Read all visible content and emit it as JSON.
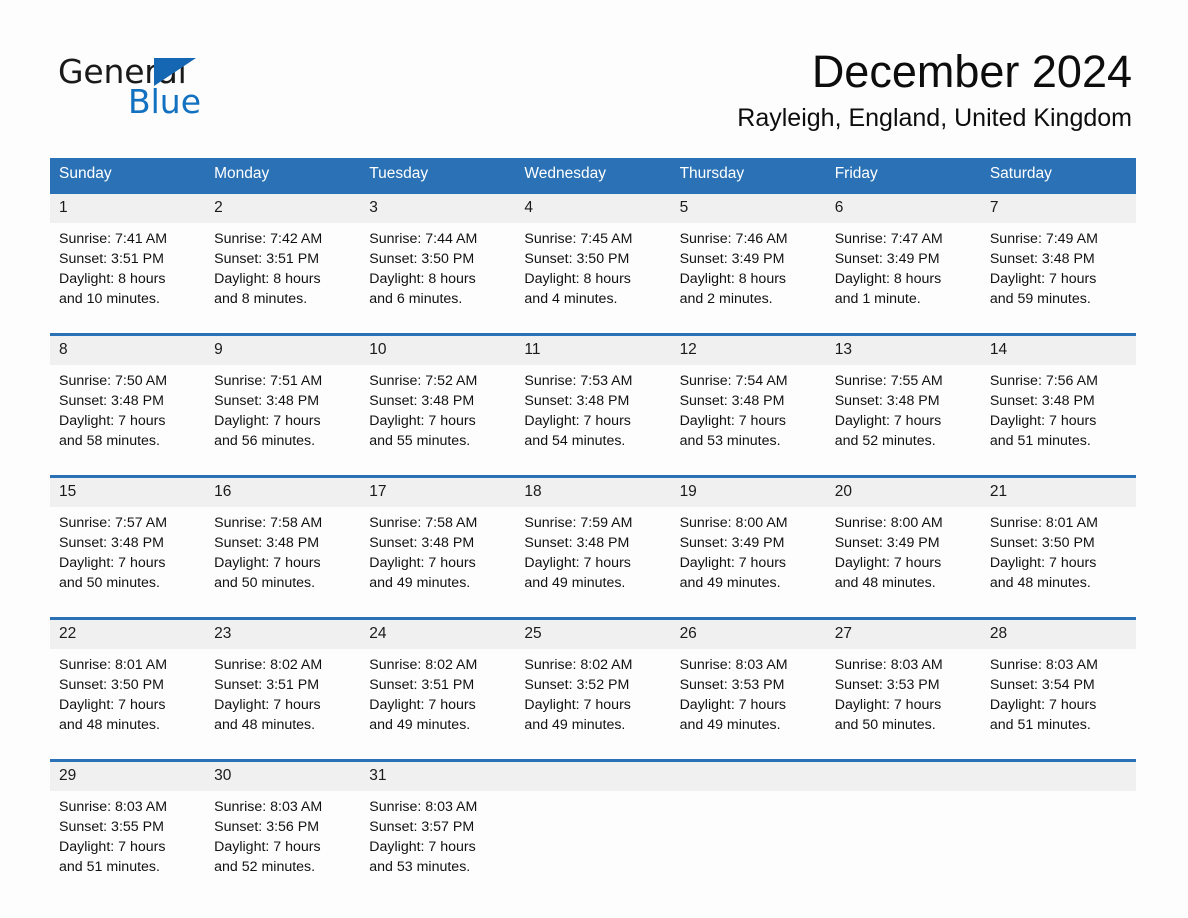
{
  "brand": {
    "line1": "General",
    "line2": "Blue",
    "triangle_color": "#1667b3",
    "blue_text_color": "#1271c0"
  },
  "header": {
    "month_title": "December 2024",
    "location": "Rayleigh, England, United Kingdom"
  },
  "theme": {
    "header_blue": "#2a72b5",
    "daynum_band": "#f0f0f0",
    "page_bg": "#fdfdfd"
  },
  "weekday_headers": [
    "Sunday",
    "Monday",
    "Tuesday",
    "Wednesday",
    "Thursday",
    "Friday",
    "Saturday"
  ],
  "weeks": [
    {
      "days": [
        {
          "date": "1",
          "sunrise": "Sunrise: 7:41 AM",
          "sunset": "Sunset: 3:51 PM",
          "daylight_1": "Daylight: 8 hours",
          "daylight_2": "and 10 minutes."
        },
        {
          "date": "2",
          "sunrise": "Sunrise: 7:42 AM",
          "sunset": "Sunset: 3:51 PM",
          "daylight_1": "Daylight: 8 hours",
          "daylight_2": "and 8 minutes."
        },
        {
          "date": "3",
          "sunrise": "Sunrise: 7:44 AM",
          "sunset": "Sunset: 3:50 PM",
          "daylight_1": "Daylight: 8 hours",
          "daylight_2": "and 6 minutes."
        },
        {
          "date": "4",
          "sunrise": "Sunrise: 7:45 AM",
          "sunset": "Sunset: 3:50 PM",
          "daylight_1": "Daylight: 8 hours",
          "daylight_2": "and 4 minutes."
        },
        {
          "date": "5",
          "sunrise": "Sunrise: 7:46 AM",
          "sunset": "Sunset: 3:49 PM",
          "daylight_1": "Daylight: 8 hours",
          "daylight_2": "and 2 minutes."
        },
        {
          "date": "6",
          "sunrise": "Sunrise: 7:47 AM",
          "sunset": "Sunset: 3:49 PM",
          "daylight_1": "Daylight: 8 hours",
          "daylight_2": "and 1 minute."
        },
        {
          "date": "7",
          "sunrise": "Sunrise: 7:49 AM",
          "sunset": "Sunset: 3:48 PM",
          "daylight_1": "Daylight: 7 hours",
          "daylight_2": "and 59 minutes."
        }
      ]
    },
    {
      "days": [
        {
          "date": "8",
          "sunrise": "Sunrise: 7:50 AM",
          "sunset": "Sunset: 3:48 PM",
          "daylight_1": "Daylight: 7 hours",
          "daylight_2": "and 58 minutes."
        },
        {
          "date": "9",
          "sunrise": "Sunrise: 7:51 AM",
          "sunset": "Sunset: 3:48 PM",
          "daylight_1": "Daylight: 7 hours",
          "daylight_2": "and 56 minutes."
        },
        {
          "date": "10",
          "sunrise": "Sunrise: 7:52 AM",
          "sunset": "Sunset: 3:48 PM",
          "daylight_1": "Daylight: 7 hours",
          "daylight_2": "and 55 minutes."
        },
        {
          "date": "11",
          "sunrise": "Sunrise: 7:53 AM",
          "sunset": "Sunset: 3:48 PM",
          "daylight_1": "Daylight: 7 hours",
          "daylight_2": "and 54 minutes."
        },
        {
          "date": "12",
          "sunrise": "Sunrise: 7:54 AM",
          "sunset": "Sunset: 3:48 PM",
          "daylight_1": "Daylight: 7 hours",
          "daylight_2": "and 53 minutes."
        },
        {
          "date": "13",
          "sunrise": "Sunrise: 7:55 AM",
          "sunset": "Sunset: 3:48 PM",
          "daylight_1": "Daylight: 7 hours",
          "daylight_2": "and 52 minutes."
        },
        {
          "date": "14",
          "sunrise": "Sunrise: 7:56 AM",
          "sunset": "Sunset: 3:48 PM",
          "daylight_1": "Daylight: 7 hours",
          "daylight_2": "and 51 minutes."
        }
      ]
    },
    {
      "days": [
        {
          "date": "15",
          "sunrise": "Sunrise: 7:57 AM",
          "sunset": "Sunset: 3:48 PM",
          "daylight_1": "Daylight: 7 hours",
          "daylight_2": "and 50 minutes."
        },
        {
          "date": "16",
          "sunrise": "Sunrise: 7:58 AM",
          "sunset": "Sunset: 3:48 PM",
          "daylight_1": "Daylight: 7 hours",
          "daylight_2": "and 50 minutes."
        },
        {
          "date": "17",
          "sunrise": "Sunrise: 7:58 AM",
          "sunset": "Sunset: 3:48 PM",
          "daylight_1": "Daylight: 7 hours",
          "daylight_2": "and 49 minutes."
        },
        {
          "date": "18",
          "sunrise": "Sunrise: 7:59 AM",
          "sunset": "Sunset: 3:48 PM",
          "daylight_1": "Daylight: 7 hours",
          "daylight_2": "and 49 minutes."
        },
        {
          "date": "19",
          "sunrise": "Sunrise: 8:00 AM",
          "sunset": "Sunset: 3:49 PM",
          "daylight_1": "Daylight: 7 hours",
          "daylight_2": "and 49 minutes."
        },
        {
          "date": "20",
          "sunrise": "Sunrise: 8:00 AM",
          "sunset": "Sunset: 3:49 PM",
          "daylight_1": "Daylight: 7 hours",
          "daylight_2": "and 48 minutes."
        },
        {
          "date": "21",
          "sunrise": "Sunrise: 8:01 AM",
          "sunset": "Sunset: 3:50 PM",
          "daylight_1": "Daylight: 7 hours",
          "daylight_2": "and 48 minutes."
        }
      ]
    },
    {
      "days": [
        {
          "date": "22",
          "sunrise": "Sunrise: 8:01 AM",
          "sunset": "Sunset: 3:50 PM",
          "daylight_1": "Daylight: 7 hours",
          "daylight_2": "and 48 minutes."
        },
        {
          "date": "23",
          "sunrise": "Sunrise: 8:02 AM",
          "sunset": "Sunset: 3:51 PM",
          "daylight_1": "Daylight: 7 hours",
          "daylight_2": "and 48 minutes."
        },
        {
          "date": "24",
          "sunrise": "Sunrise: 8:02 AM",
          "sunset": "Sunset: 3:51 PM",
          "daylight_1": "Daylight: 7 hours",
          "daylight_2": "and 49 minutes."
        },
        {
          "date": "25",
          "sunrise": "Sunrise: 8:02 AM",
          "sunset": "Sunset: 3:52 PM",
          "daylight_1": "Daylight: 7 hours",
          "daylight_2": "and 49 minutes."
        },
        {
          "date": "26",
          "sunrise": "Sunrise: 8:03 AM",
          "sunset": "Sunset: 3:53 PM",
          "daylight_1": "Daylight: 7 hours",
          "daylight_2": "and 49 minutes."
        },
        {
          "date": "27",
          "sunrise": "Sunrise: 8:03 AM",
          "sunset": "Sunset: 3:53 PM",
          "daylight_1": "Daylight: 7 hours",
          "daylight_2": "and 50 minutes."
        },
        {
          "date": "28",
          "sunrise": "Sunrise: 8:03 AM",
          "sunset": "Sunset: 3:54 PM",
          "daylight_1": "Daylight: 7 hours",
          "daylight_2": "and 51 minutes."
        }
      ]
    },
    {
      "days": [
        {
          "date": "29",
          "sunrise": "Sunrise: 8:03 AM",
          "sunset": "Sunset: 3:55 PM",
          "daylight_1": "Daylight: 7 hours",
          "daylight_2": "and 51 minutes."
        },
        {
          "date": "30",
          "sunrise": "Sunrise: 8:03 AM",
          "sunset": "Sunset: 3:56 PM",
          "daylight_1": "Daylight: 7 hours",
          "daylight_2": "and 52 minutes."
        },
        {
          "date": "31",
          "sunrise": "Sunrise: 8:03 AM",
          "sunset": "Sunset: 3:57 PM",
          "daylight_1": "Daylight: 7 hours",
          "daylight_2": "and 53 minutes."
        },
        {
          "date": "",
          "sunrise": "",
          "sunset": "",
          "daylight_1": "",
          "daylight_2": ""
        },
        {
          "date": "",
          "sunrise": "",
          "sunset": "",
          "daylight_1": "",
          "daylight_2": ""
        },
        {
          "date": "",
          "sunrise": "",
          "sunset": "",
          "daylight_1": "",
          "daylight_2": ""
        },
        {
          "date": "",
          "sunrise": "",
          "sunset": "",
          "daylight_1": "",
          "daylight_2": ""
        }
      ]
    }
  ]
}
